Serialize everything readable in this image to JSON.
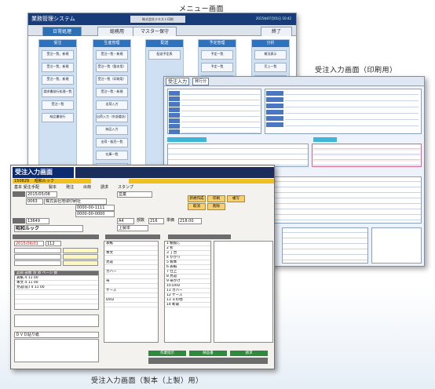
{
  "captions": {
    "menu": "メニュー画面",
    "print": "受注入力画面（印刷用）",
    "production": "受注入力画面（製本（上製）用）"
  },
  "menu_window": {
    "title": "業務管理システム",
    "company": "株式会社テキスト印刷",
    "datetime": "2015年07月01日 10:42",
    "tabs": [
      "日常処理",
      "総務用",
      "マスター保守"
    ],
    "exit": "終了",
    "columns": [
      {
        "header": "受注",
        "buttons": [
          "受注一覧、新規",
          "受注一覧、新規",
          "受注一覧、新規",
          "請求書発行処理一覧",
          "受注一覧",
          "納品書発行"
        ]
      },
      {
        "header": "生産管理",
        "buttons": [
          "受注一覧・新規",
          "受注一覧（製本用）",
          "受注一覧（印刷用）",
          "受注一覧・新規",
          "出荷入力",
          "出荷入力（外部委託）",
          "納品入力",
          "出荷・販売一覧",
          "在庫一覧",
          "在庫一覧"
        ]
      },
      {
        "header": "配送",
        "buttons": [
          "配送予定表"
        ]
      },
      {
        "header": "予定管理",
        "buttons": [
          "予定一覧",
          "予定一覧",
          "予定表"
        ]
      },
      {
        "header": "分析",
        "buttons": [
          "概況表示",
          "売上一覧",
          "取引先一覧"
        ]
      }
    ]
  },
  "print_window": {
    "title": "受注入力",
    "tab": "発行分"
  },
  "production_window": {
    "title": "受注入力画面",
    "order_no": "150829",
    "order_name": "昭和ルック",
    "menu_items": [
      "基本 受注",
      "手配",
      "製本",
      "発注",
      "出荷",
      "請求",
      "スタンプ"
    ],
    "fields": {
      "date1": "2015/05/08",
      "customer_code": "0063",
      "customer_name": "株式会社地球印刷社",
      "tel": "0000-00-1111",
      "fax": "0000-00-0000",
      "item_no": "13649",
      "title_label": "昭和ルック",
      "dept": "営業",
      "size": "A4",
      "qty_label": "部数",
      "qty": "216",
      "price_label": "単価",
      "total": "218.00",
      "delivery_date": "2015/06/01",
      "pages": "112",
      "binding": "上製本"
    },
    "left_table": {
      "headers": [
        "品目",
        "部数",
        "頁",
        "原",
        "ページ",
        "数"
      ],
      "rows": [
        [
          "表紙",
          "4",
          "11",
          "00"
        ],
        [
          "本文",
          "4",
          "11",
          "00"
        ],
        [
          "見返(前)",
          "4",
          "11",
          "00"
        ]
      ]
    },
    "process_list": [
      "1 紙揃し",
      "2 折",
      "3 丁合",
      "4 かがり",
      "5 製本",
      "6 表紙",
      "7 仕上",
      "8 見返",
      "9 帯かけ",
      "10 DVD",
      "11 カバー",
      "12 ケース",
      "13 その他",
      "14 断裁"
    ],
    "material_list": [
      "表紙",
      "本文",
      "見返",
      "カバー",
      "帯",
      "ケース",
      "DVD"
    ],
    "right_buttons": [
      "新規作成",
      "印刷",
      "複写",
      "取消",
      "削除"
    ],
    "memo": "ＤＶＤ貼り紙",
    "status_buttons": [
      "作業指示",
      "納品書",
      "請求"
    ]
  },
  "colors": {
    "menu_title": "#183c7a",
    "menu_tab_active": "#2c70b8",
    "production_title": "#0b2a70",
    "yellow_bar": "#f0c020",
    "green_button": "#2e8a3c"
  }
}
